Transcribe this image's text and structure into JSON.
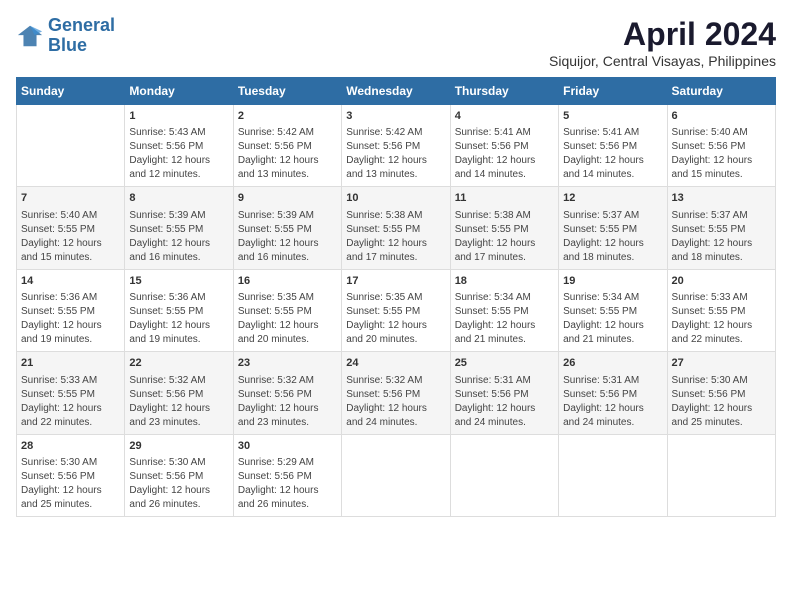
{
  "logo": {
    "line1": "General",
    "line2": "Blue"
  },
  "title": "April 2024",
  "location": "Siquijor, Central Visayas, Philippines",
  "headers": [
    "Sunday",
    "Monday",
    "Tuesday",
    "Wednesday",
    "Thursday",
    "Friday",
    "Saturday"
  ],
  "weeks": [
    [
      {
        "day": "",
        "info": ""
      },
      {
        "day": "1",
        "info": "Sunrise: 5:43 AM\nSunset: 5:56 PM\nDaylight: 12 hours\nand 12 minutes."
      },
      {
        "day": "2",
        "info": "Sunrise: 5:42 AM\nSunset: 5:56 PM\nDaylight: 12 hours\nand 13 minutes."
      },
      {
        "day": "3",
        "info": "Sunrise: 5:42 AM\nSunset: 5:56 PM\nDaylight: 12 hours\nand 13 minutes."
      },
      {
        "day": "4",
        "info": "Sunrise: 5:41 AM\nSunset: 5:56 PM\nDaylight: 12 hours\nand 14 minutes."
      },
      {
        "day": "5",
        "info": "Sunrise: 5:41 AM\nSunset: 5:56 PM\nDaylight: 12 hours\nand 14 minutes."
      },
      {
        "day": "6",
        "info": "Sunrise: 5:40 AM\nSunset: 5:56 PM\nDaylight: 12 hours\nand 15 minutes."
      }
    ],
    [
      {
        "day": "7",
        "info": "Sunrise: 5:40 AM\nSunset: 5:55 PM\nDaylight: 12 hours\nand 15 minutes."
      },
      {
        "day": "8",
        "info": "Sunrise: 5:39 AM\nSunset: 5:55 PM\nDaylight: 12 hours\nand 16 minutes."
      },
      {
        "day": "9",
        "info": "Sunrise: 5:39 AM\nSunset: 5:55 PM\nDaylight: 12 hours\nand 16 minutes."
      },
      {
        "day": "10",
        "info": "Sunrise: 5:38 AM\nSunset: 5:55 PM\nDaylight: 12 hours\nand 17 minutes."
      },
      {
        "day": "11",
        "info": "Sunrise: 5:38 AM\nSunset: 5:55 PM\nDaylight: 12 hours\nand 17 minutes."
      },
      {
        "day": "12",
        "info": "Sunrise: 5:37 AM\nSunset: 5:55 PM\nDaylight: 12 hours\nand 18 minutes."
      },
      {
        "day": "13",
        "info": "Sunrise: 5:37 AM\nSunset: 5:55 PM\nDaylight: 12 hours\nand 18 minutes."
      }
    ],
    [
      {
        "day": "14",
        "info": "Sunrise: 5:36 AM\nSunset: 5:55 PM\nDaylight: 12 hours\nand 19 minutes."
      },
      {
        "day": "15",
        "info": "Sunrise: 5:36 AM\nSunset: 5:55 PM\nDaylight: 12 hours\nand 19 minutes."
      },
      {
        "day": "16",
        "info": "Sunrise: 5:35 AM\nSunset: 5:55 PM\nDaylight: 12 hours\nand 20 minutes."
      },
      {
        "day": "17",
        "info": "Sunrise: 5:35 AM\nSunset: 5:55 PM\nDaylight: 12 hours\nand 20 minutes."
      },
      {
        "day": "18",
        "info": "Sunrise: 5:34 AM\nSunset: 5:55 PM\nDaylight: 12 hours\nand 21 minutes."
      },
      {
        "day": "19",
        "info": "Sunrise: 5:34 AM\nSunset: 5:55 PM\nDaylight: 12 hours\nand 21 minutes."
      },
      {
        "day": "20",
        "info": "Sunrise: 5:33 AM\nSunset: 5:55 PM\nDaylight: 12 hours\nand 22 minutes."
      }
    ],
    [
      {
        "day": "21",
        "info": "Sunrise: 5:33 AM\nSunset: 5:55 PM\nDaylight: 12 hours\nand 22 minutes."
      },
      {
        "day": "22",
        "info": "Sunrise: 5:32 AM\nSunset: 5:56 PM\nDaylight: 12 hours\nand 23 minutes."
      },
      {
        "day": "23",
        "info": "Sunrise: 5:32 AM\nSunset: 5:56 PM\nDaylight: 12 hours\nand 23 minutes."
      },
      {
        "day": "24",
        "info": "Sunrise: 5:32 AM\nSunset: 5:56 PM\nDaylight: 12 hours\nand 24 minutes."
      },
      {
        "day": "25",
        "info": "Sunrise: 5:31 AM\nSunset: 5:56 PM\nDaylight: 12 hours\nand 24 minutes."
      },
      {
        "day": "26",
        "info": "Sunrise: 5:31 AM\nSunset: 5:56 PM\nDaylight: 12 hours\nand 24 minutes."
      },
      {
        "day": "27",
        "info": "Sunrise: 5:30 AM\nSunset: 5:56 PM\nDaylight: 12 hours\nand 25 minutes."
      }
    ],
    [
      {
        "day": "28",
        "info": "Sunrise: 5:30 AM\nSunset: 5:56 PM\nDaylight: 12 hours\nand 25 minutes."
      },
      {
        "day": "29",
        "info": "Sunrise: 5:30 AM\nSunset: 5:56 PM\nDaylight: 12 hours\nand 26 minutes."
      },
      {
        "day": "30",
        "info": "Sunrise: 5:29 AM\nSunset: 5:56 PM\nDaylight: 12 hours\nand 26 minutes."
      },
      {
        "day": "",
        "info": ""
      },
      {
        "day": "",
        "info": ""
      },
      {
        "day": "",
        "info": ""
      },
      {
        "day": "",
        "info": ""
      }
    ]
  ]
}
